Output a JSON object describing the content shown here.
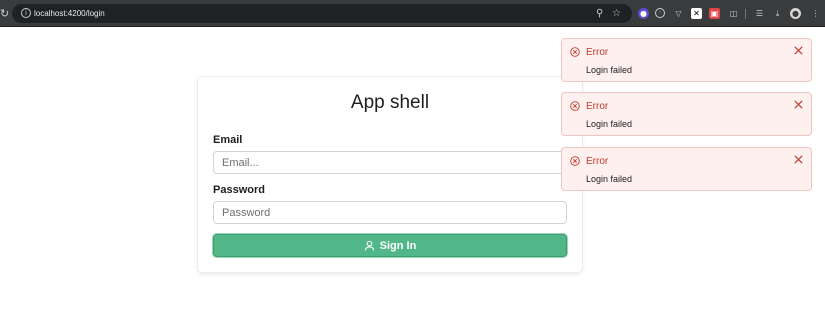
{
  "browser": {
    "url": "localhost:4200/login",
    "reload_icon": "reload-icon",
    "info_icon": "info-icon",
    "zoom_icon": "zoom-icon",
    "bookmark_icon": "star-icon",
    "extensions": [
      "extension-icon",
      "extension-icon",
      "extension-icon",
      "extension-icon",
      "extension-icon",
      "puzzle-icon"
    ],
    "reading_list_icon": "reading-list-icon",
    "download_icon": "download-icon",
    "profile_icon": "profile-avatar-icon",
    "menu_icon": "kebab-menu-icon"
  },
  "login": {
    "title": "App shell",
    "email_label": "Email",
    "email_placeholder": "Email...",
    "email_value": "",
    "password_label": "Password",
    "password_placeholder": "Password",
    "password_value": "",
    "sign_in_label": "Sign In",
    "sign_in_icon": "user-icon",
    "button_color": "#52b788"
  },
  "toasts": [
    {
      "title": "Error",
      "message": "Login failed",
      "icon": "error-circle-icon",
      "close_icon": "close-icon"
    },
    {
      "title": "Error",
      "message": "Login failed",
      "icon": "error-circle-icon",
      "close_icon": "close-icon"
    },
    {
      "title": "Error",
      "message": "Login failed",
      "icon": "error-circle-icon",
      "close_icon": "close-icon"
    }
  ],
  "colors": {
    "error": "#c0392b",
    "toast_background": "#fdf0ef",
    "chrome": "#3a3b3d"
  }
}
